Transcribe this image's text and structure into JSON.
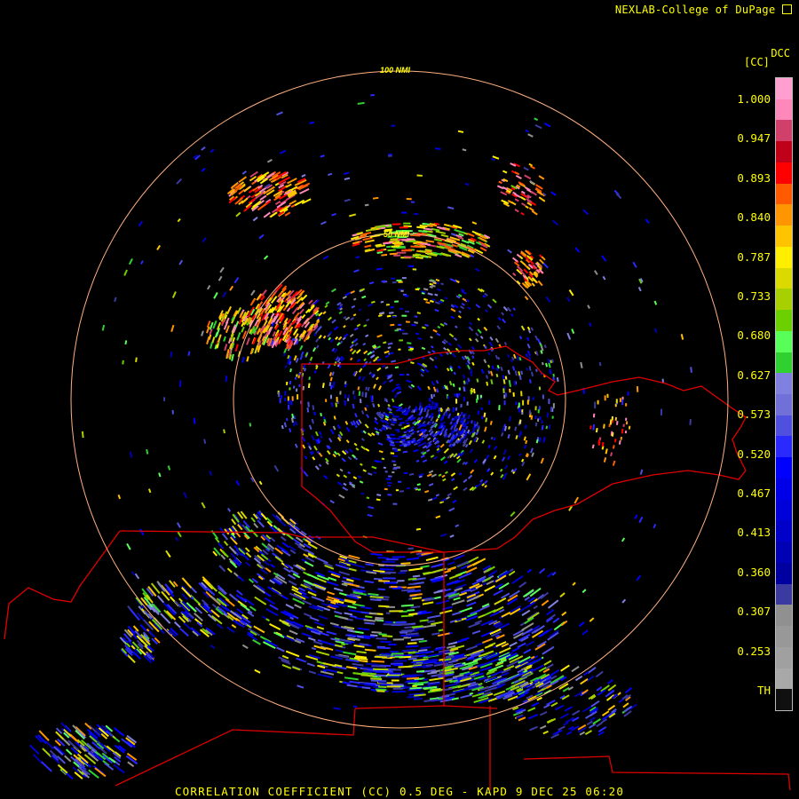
{
  "credit": "NEXLAB-College of DuPage",
  "caption": "CORRELATION COEFFICIENT (CC) 0.5 DEG - KAPD 9 DEC 25 06:20",
  "legend": {
    "product": "DCC",
    "unit": "[CC]",
    "ticks": [
      "1.000",
      "0.947",
      "0.893",
      "0.840",
      "0.787",
      "0.733",
      "0.680",
      "0.627",
      "0.573",
      "0.520",
      "0.467",
      "0.413",
      "0.360",
      "0.307",
      "0.253",
      "TH"
    ],
    "colors": [
      "#ff9fcf",
      "#ff88bb",
      "#d0406a",
      "#c00018",
      "#ff0000",
      "#ff5a00",
      "#ff9500",
      "#ffc400",
      "#ffee00",
      "#dada00",
      "#a8d000",
      "#6cd000",
      "#58ff58",
      "#30d030",
      "#8080e0",
      "#7070d8",
      "#5050e0",
      "#2a2aff",
      "#0000ff",
      "#0000e8",
      "#0000d8",
      "#0000c8",
      "#0000b4",
      "#0000a0",
      "#3a3aa0",
      "#909090",
      "#989898",
      "#a0a0a0",
      "#a8a8a8",
      "#101010"
    ]
  },
  "rings": [
    {
      "label": "50 NMI"
    },
    {
      "label": "100 NMI"
    }
  ],
  "icons": [
    "external-link-icon"
  ]
}
